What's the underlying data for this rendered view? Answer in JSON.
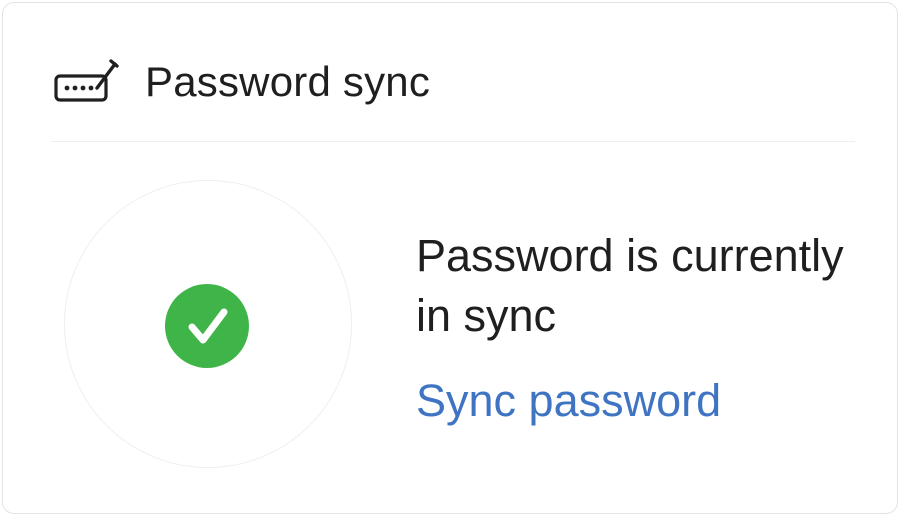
{
  "header": {
    "icon": "password-edit-icon",
    "title": "Password sync"
  },
  "status": {
    "icon": "check-circle-icon",
    "icon_color": "#3fb549",
    "message": "Password is currently in sync"
  },
  "actions": {
    "sync_label": "Sync password",
    "link_color": "#3f74c2"
  }
}
